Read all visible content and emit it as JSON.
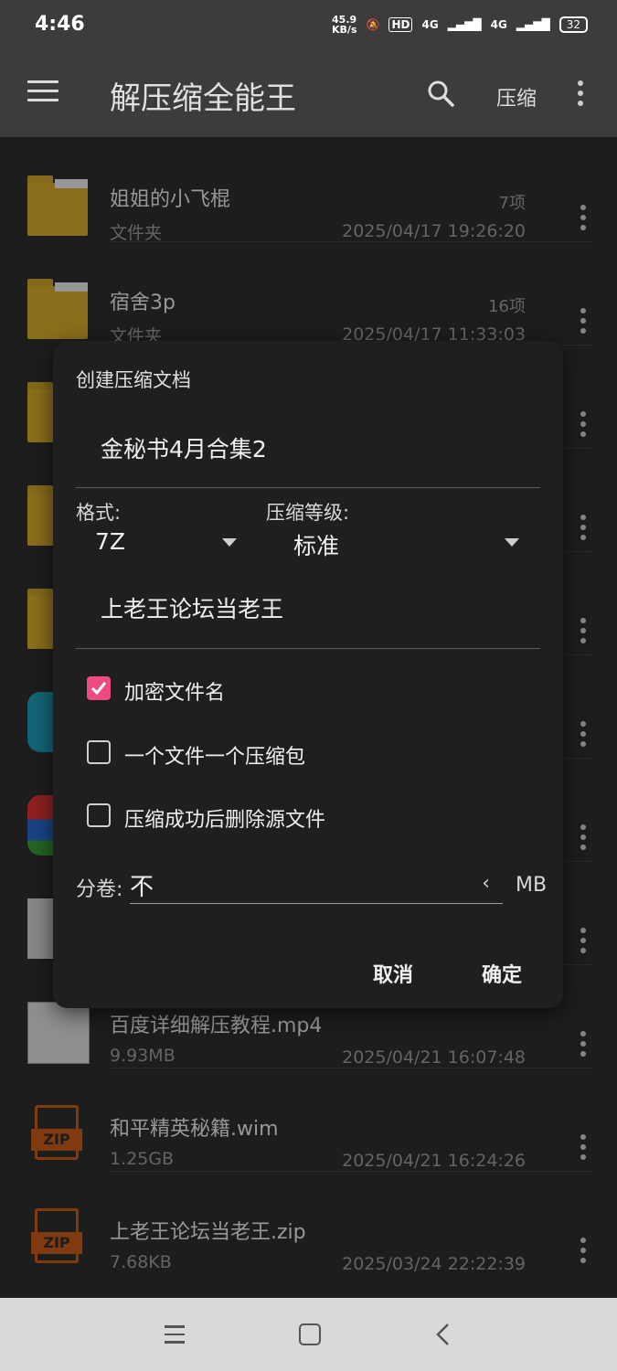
{
  "status_bar": {
    "time": "4:46",
    "speed_value": "45.9",
    "speed_unit": "KB/s",
    "network_1": "4G",
    "network_2": "4G",
    "hd": "HD",
    "battery": "32"
  },
  "app_bar": {
    "title": "解压缩全能王",
    "compress_label": "压缩"
  },
  "files": [
    {
      "name": "姐姐的小飞棍",
      "sub": "文件夹",
      "count": "7项",
      "date": "2025/04/17 19:26:20",
      "icon": "folder-icon"
    },
    {
      "name": "宿舍3p",
      "sub": "文件夹",
      "count": "16项",
      "date": "2025/04/17 11:33:03",
      "icon": "folder-icon"
    },
    {
      "name": "百度详细解压教程.mp4",
      "sub": "9.93MB",
      "date": "2025/04/21 16:07:48",
      "icon": "video-thumbnail"
    },
    {
      "name": "和平精英秘籍.wim",
      "sub": "1.25GB",
      "date": "2025/04/21 16:24:26",
      "icon": "zip-icon",
      "icon_label": "ZIP"
    },
    {
      "name": "上老王论坛当老王.zip",
      "sub": "7.68KB",
      "date": "2025/03/24 22:22:39",
      "icon": "zip-icon",
      "icon_label": "ZIP"
    }
  ],
  "dialog": {
    "title": "创建压缩文档",
    "filename": "金秘书4月合集2",
    "format_label": "格式:",
    "format_value": "7Z",
    "level_label": "压缩等级:",
    "level_value": "标准",
    "password": "上老王论坛当老王",
    "options": [
      {
        "label": "加密文件名",
        "checked": true
      },
      {
        "label": "一个文件一个压缩包",
        "checked": false
      },
      {
        "label": "压缩成功后删除源文件",
        "checked": false
      }
    ],
    "volume_label": "分卷:",
    "volume_value": "不",
    "volume_unit": "MB",
    "cancel": "取消",
    "confirm": "确定",
    "accent_color": "#ee4b83"
  }
}
